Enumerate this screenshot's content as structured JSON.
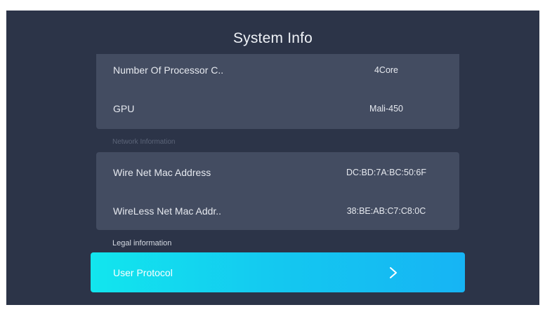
{
  "title": "System Info",
  "hardware": {
    "rows": [
      {
        "label": "Number Of Processor C..",
        "value": "4Core"
      },
      {
        "label": "GPU",
        "value": "Mali-450"
      }
    ]
  },
  "network": {
    "section_label": "Network Information",
    "rows": [
      {
        "label": "Wire Net Mac Address",
        "value": "DC:BD:7A:BC:50:6F"
      },
      {
        "label": "WireLess Net Mac Addr..",
        "value": "38:BE:AB:C7:C8:0C"
      }
    ]
  },
  "legal": {
    "section_label": "Legal information",
    "item": {
      "label": "User Protocol",
      "icon": "chevron-right-icon"
    }
  },
  "colors": {
    "background": "#2c3448",
    "card": "#434c61",
    "accent_start": "#12e6ee",
    "accent_end": "#16b4f4"
  }
}
